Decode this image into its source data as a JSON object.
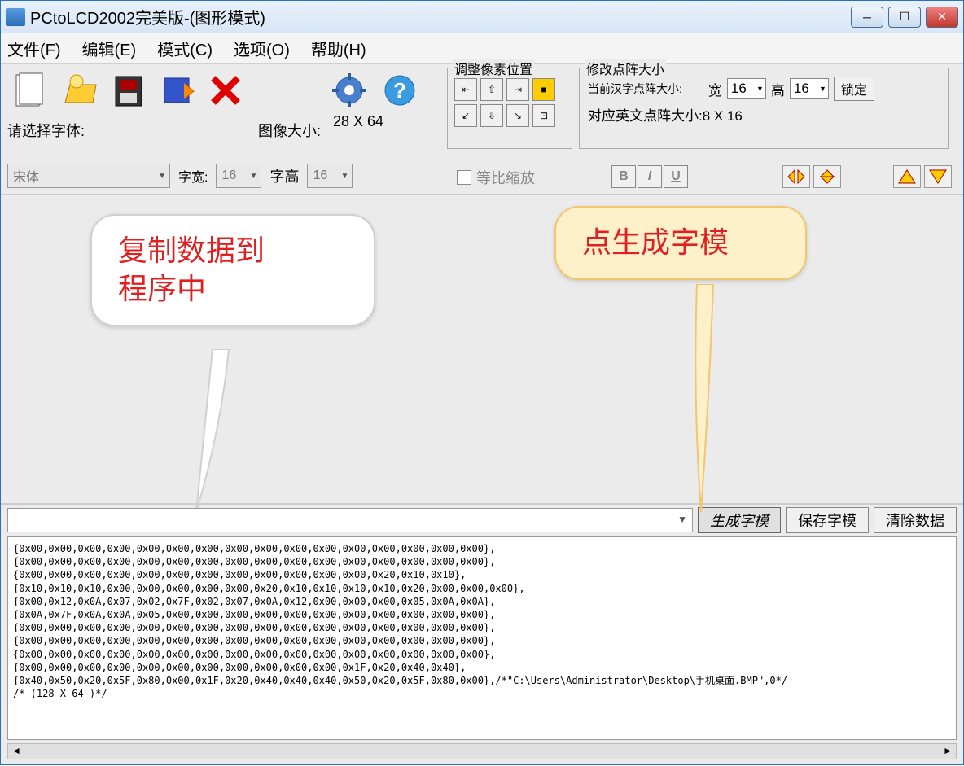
{
  "window": {
    "title": "PCtoLCD2002完美版-(图形模式)"
  },
  "menu": {
    "file": "文件(F)",
    "edit": "编辑(E)",
    "mode": "模式(C)",
    "options": "选项(O)",
    "help": "帮助(H)"
  },
  "toolbar": {
    "font_select_label": "请选择字体:",
    "font_value": "宋体",
    "image_size_label": "图像大小:",
    "image_size_value": "28 X 64",
    "char_width_label": "字宽:",
    "char_width_value": "16",
    "char_height_label": "字高",
    "char_height_value": "16",
    "equal_scale": "等比缩放",
    "adjust_pixel": "调整像素位置",
    "modify_matrix": "修改点阵大小",
    "current_cn_size": "当前汉字点阵大小:",
    "width_label": "宽",
    "width_value": "16",
    "height_label": "高",
    "height_value": "16",
    "lock": "锁定",
    "en_matrix": "对应英文点阵大小:8 X 16",
    "b": "B",
    "i": "I",
    "u": "U"
  },
  "callouts": {
    "c1_line1": "复制数据到",
    "c1_line2": "程序中",
    "c2": "点生成字模"
  },
  "output_buttons": {
    "generate": "生成字模",
    "save": "保存字模",
    "clear": "清除数据"
  },
  "output_text": "{0x00,0x00,0x00,0x00,0x00,0x00,0x00,0x00,0x00,0x00,0x00,0x00,0x00,0x00,0x00,0x00},\n{0x00,0x00,0x00,0x00,0x00,0x00,0x00,0x00,0x00,0x00,0x00,0x00,0x00,0x00,0x00,0x00},\n{0x00,0x00,0x00,0x00,0x00,0x00,0x00,0x00,0x00,0x00,0x00,0x00,0x20,0x10,0x10},\n{0x10,0x10,0x10,0x00,0x00,0x00,0x00,0x00,0x20,0x10,0x10,0x10,0x10,0x20,0x00,0x00,0x00},\n{0x00,0x12,0x0A,0x07,0x02,0x7F,0x02,0x07,0x0A,0x12,0x00,0x00,0x00,0x05,0x0A,0x0A},\n{0x0A,0x7F,0x0A,0x0A,0x05,0x00,0x00,0x00,0x00,0x00,0x00,0x00,0x00,0x00,0x00,0x00},\n{0x00,0x00,0x00,0x00,0x00,0x00,0x00,0x00,0x00,0x00,0x00,0x00,0x00,0x00,0x00,0x00},\n{0x00,0x00,0x00,0x00,0x00,0x00,0x00,0x00,0x00,0x00,0x00,0x00,0x00,0x00,0x00,0x00},\n{0x00,0x00,0x00,0x00,0x00,0x00,0x00,0x00,0x00,0x00,0x00,0x00,0x00,0x00,0x00,0x00},\n{0x00,0x00,0x00,0x00,0x00,0x00,0x00,0x00,0x00,0x00,0x00,0x1F,0x20,0x40,0x40},\n{0x40,0x50,0x20,0x5F,0x80,0x00,0x1F,0x20,0x40,0x40,0x40,0x50,0x20,0x5F,0x80,0x00},/*\"C:\\Users\\Administrator\\Desktop\\手机桌面.BMP\",0*/\n/* (128 X 64 )*/"
}
